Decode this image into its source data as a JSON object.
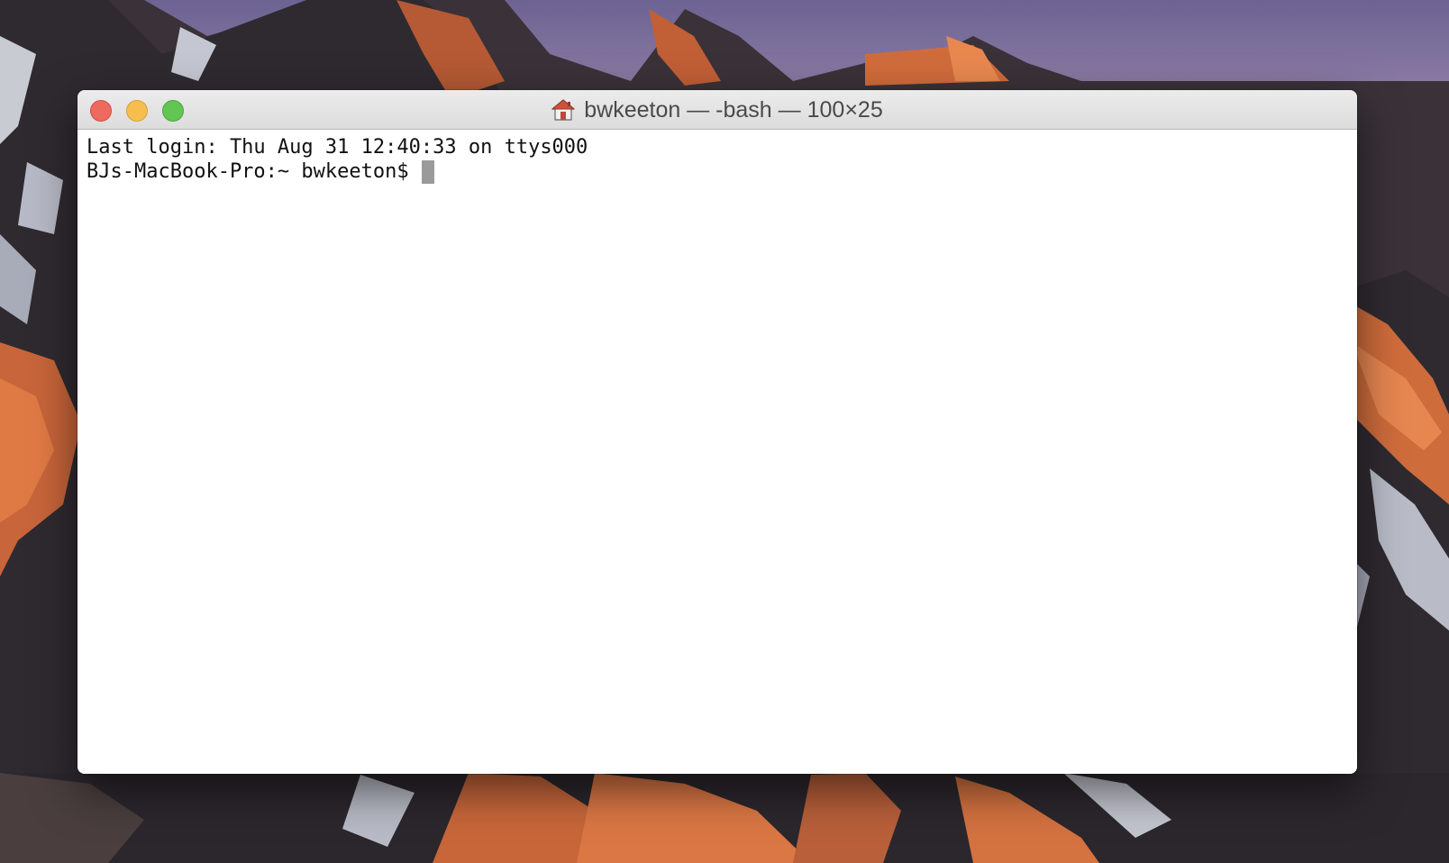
{
  "colors": {
    "close_button": "#ee6a5f",
    "minimize_button": "#f5be4f",
    "zoom_button": "#62c554",
    "terminal_background": "#ffffff",
    "terminal_text": "#111111",
    "cursor": "#9a9a9a"
  },
  "window": {
    "title": "bwkeeton — -bash — 100×25",
    "title_icon": "home-folder-icon"
  },
  "terminal": {
    "lines": [
      "Last login: Thu Aug 31 12:40:33 on ttys000",
      "BJs-MacBook-Pro:~ bwkeeton$"
    ]
  }
}
